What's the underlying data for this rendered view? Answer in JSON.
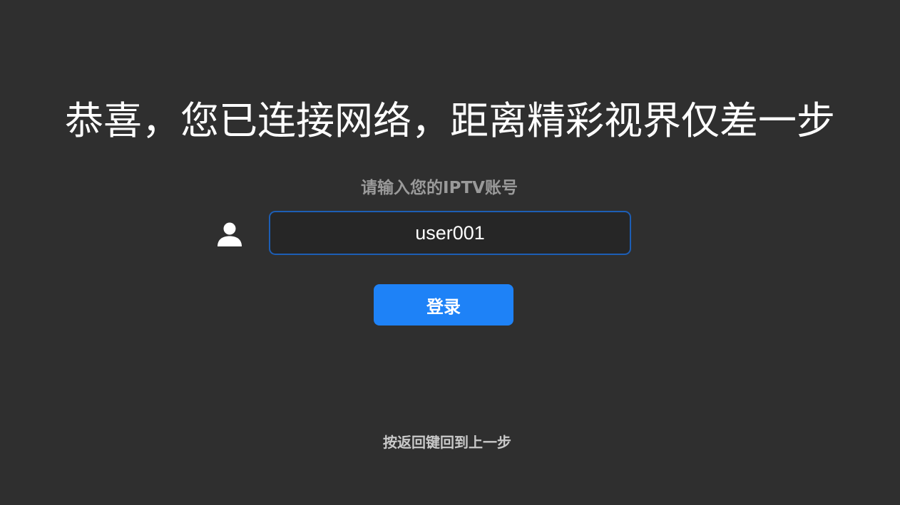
{
  "headline": "恭喜，您已连接网络，距离精彩视界仅差一步",
  "prompt": "请输入您的IPTV账号",
  "account_input": {
    "value": "user001",
    "icon": "user-icon"
  },
  "login_button": {
    "label": "登录"
  },
  "hint": "按返回键回到上一步",
  "colors": {
    "background": "#2f2f2f",
    "accent": "#1e82f7",
    "input_border": "#1d5eb5",
    "input_background": "#262626"
  }
}
